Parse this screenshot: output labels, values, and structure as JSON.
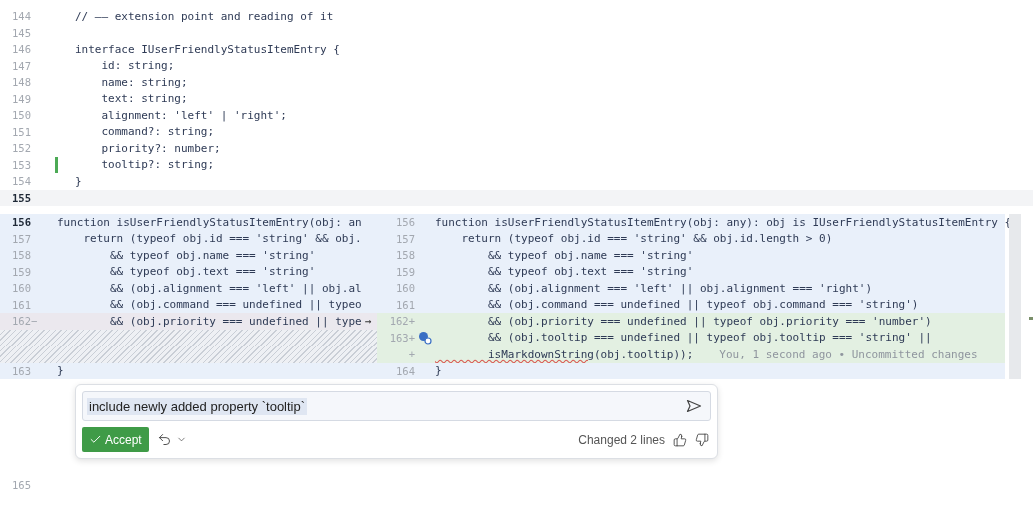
{
  "editor": {
    "lines": [
      {
        "number": "144",
        "text": "// —— extension point and reading of it",
        "changed": false,
        "current": false
      },
      {
        "number": "145",
        "changed": false,
        "current": false
      },
      {
        "number": "146",
        "text": "interface IUserFriendlyStatusItemEntry {",
        "changed": false,
        "current": false
      },
      {
        "number": "147",
        "text": "    id: string;",
        "changed": false,
        "current": false
      },
      {
        "number": "148",
        "text": "    name: string;",
        "changed": false,
        "current": false
      },
      {
        "number": "149",
        "text": "    text: string;",
        "changed": false,
        "current": false
      },
      {
        "number": "150",
        "text": "    alignment: 'left' | 'right';",
        "changed": false,
        "current": false
      },
      {
        "number": "151",
        "text": "    command?: string;",
        "changed": false,
        "current": false
      },
      {
        "number": "152",
        "text": "    priority?: number;",
        "changed": false,
        "current": false
      },
      {
        "number": "153",
        "text": "    tooltip?: string;",
        "changed": true,
        "current": false
      },
      {
        "number": "154",
        "text": "}",
        "changed": false,
        "current": false
      },
      {
        "number": "155",
        "changed": false,
        "current": true
      }
    ]
  },
  "diff": {
    "left": [
      {
        "kind": "context",
        "number": "156",
        "text": "function isUserFriendlyStatusItemEntry(obj: an"
      },
      {
        "kind": "context",
        "number": "157",
        "text": "    return (typeof obj.id === 'string' && obj."
      },
      {
        "kind": "context",
        "number": "158",
        "text": "        && typeof obj.name === 'string'"
      },
      {
        "kind": "context",
        "number": "159",
        "text": "        && typeof obj.text === 'string'"
      },
      {
        "kind": "context",
        "number": "160",
        "text": "        && (obj.alignment === 'left' || obj.al"
      },
      {
        "kind": "context",
        "number": "161",
        "text": "        && (obj.command === undefined || typeo"
      },
      {
        "kind": "removed",
        "number": "162−",
        "text": "        && (obj.priority === undefined || type",
        "arrow": "→"
      },
      {
        "kind": "filler"
      },
      {
        "kind": "filler"
      },
      {
        "kind": "context",
        "number": "163",
        "text": "}"
      }
    ],
    "right": [
      {
        "kind": "context",
        "number": "156",
        "text": "function isUserFriendlyStatusItemEntry(obj: any): obj is IUserFriendlyStatusItemEntry {",
        "marker": false
      },
      {
        "kind": "context",
        "number": "157",
        "text": "    return (typeof obj.id === 'string' && obj.id.length > 0)",
        "marker": false
      },
      {
        "kind": "context",
        "number": "158",
        "text": "        && typeof obj.name === 'string'",
        "marker": false
      },
      {
        "kind": "context",
        "number": "159",
        "text": "        && typeof obj.text === 'string'",
        "marker": false
      },
      {
        "kind": "context",
        "number": "160",
        "text": "        && (obj.alignment === 'left' || obj.alignment === 'right')",
        "marker": false
      },
      {
        "kind": "context",
        "number": "161",
        "text": "        && (obj.command === undefined || typeof obj.command === 'string')",
        "marker": false
      },
      {
        "kind": "added",
        "number": "162+",
        "text": "        && (obj.priority === undefined || typeof obj.priority === 'number')",
        "marker": false
      },
      {
        "kind": "added",
        "number": "163+",
        "text": "        && (obj.tooltip === undefined || typeof obj.tooltip === 'string' ||",
        "marker": true
      },
      {
        "kind": "added",
        "number": "+",
        "error": "        isMarkdownString",
        "text": "(obj.tooltip));",
        "annotation": "You, 1 second ago • Uncommitted changes",
        "marker": false
      },
      {
        "kind": "context",
        "number": "164",
        "text": "}",
        "marker": false
      }
    ]
  },
  "prompt": {
    "value": "include newly added property `tooltip`",
    "accept": "Accept",
    "status": "Changed 2 lines"
  },
  "trailing_line": {
    "number": "165"
  }
}
